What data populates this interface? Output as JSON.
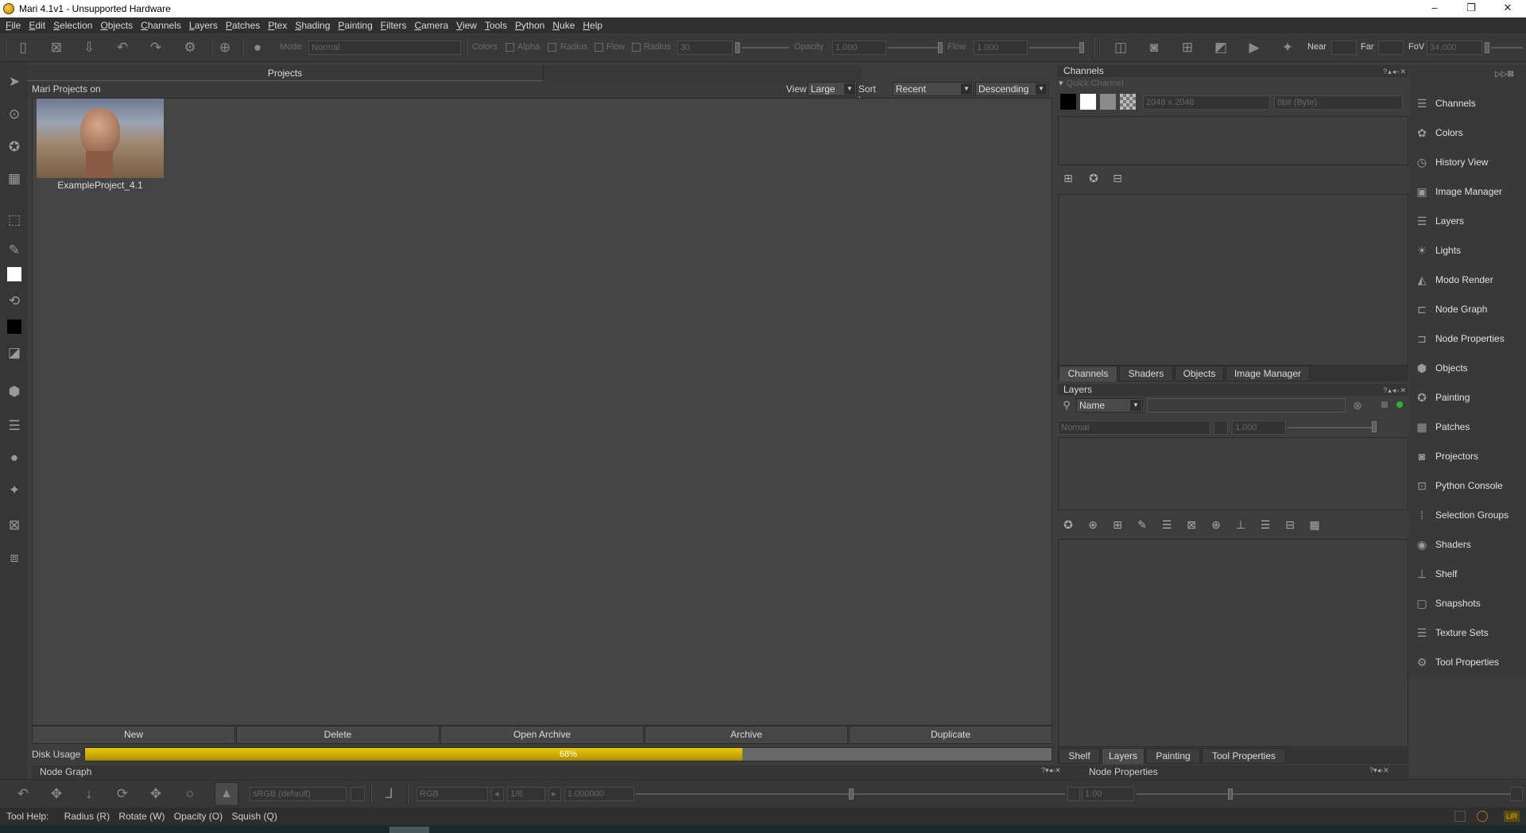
{
  "window": {
    "title": "Mari 4.1v1 - Unsupported Hardware",
    "min": "–",
    "max": "❐",
    "close": "✕"
  },
  "menu": [
    "File",
    "Edit",
    "Selection",
    "Objects",
    "Channels",
    "Layers",
    "Patches",
    "Ptex",
    "Shading",
    "Painting",
    "Filters",
    "Camera",
    "View",
    "Tools",
    "Python",
    "Nuke",
    "Help"
  ],
  "toolbar": {
    "mode_label": "Mode",
    "mode_value": "Normal",
    "colors_label": "Colors",
    "alpha_label": "Alpha",
    "radius_label": "Radius",
    "flow_label": "Flow",
    "radius2_label": "Radius",
    "radius_value": "30",
    "opacity_label": "Opacity",
    "opacity_value": "1.000",
    "flow2_label": "Flow",
    "flow_value": "1.000",
    "near_label": "Near",
    "far_label": "Far",
    "fov_label": "FoV",
    "fov_value": "34.000"
  },
  "projects": {
    "tab": "Projects",
    "heading": "Mari Projects on",
    "view_label": "View",
    "view_value": "Large",
    "sort_label": "Sort by",
    "sort_value": "Recent",
    "order_value": "Descending",
    "items": [
      {
        "name": "ExampleProject_4.1"
      }
    ],
    "buttons": {
      "new": "New",
      "delete": "Delete",
      "open_archive": "Open Archive",
      "archive": "Archive",
      "duplicate": "Duplicate"
    },
    "disk_label": "Disk Usage",
    "disk_percent": 68,
    "disk_text": "68%"
  },
  "channels_panel": {
    "title": "Channels",
    "quick_channel": "Quick Channel",
    "size_value": "2048 x 2048",
    "depth_value": "8bit (Byte)",
    "tabs": [
      "Channels",
      "Shaders",
      "Objects",
      "Image Manager"
    ]
  },
  "layers_panel": {
    "title": "Layers",
    "filter_value": "Name",
    "blend_value": "Normal",
    "opacity_value": "1.000",
    "tabs": [
      "Shelf",
      "Layers",
      "Painting",
      "Tool Properties"
    ]
  },
  "palettes": [
    {
      "label": "Channels",
      "icon": "channels-icon"
    },
    {
      "label": "Colors",
      "icon": "colors-icon"
    },
    {
      "label": "History View",
      "icon": "history-icon"
    },
    {
      "label": "Image Manager",
      "icon": "image-manager-icon"
    },
    {
      "label": "Layers",
      "icon": "layers-icon"
    },
    {
      "label": "Lights",
      "icon": "lights-icon"
    },
    {
      "label": "Modo Render",
      "icon": "modo-render-icon"
    },
    {
      "label": "Node Graph",
      "icon": "node-graph-icon"
    },
    {
      "label": "Node Properties",
      "icon": "node-properties-icon"
    },
    {
      "label": "Objects",
      "icon": "objects-icon"
    },
    {
      "label": "Painting",
      "icon": "painting-icon"
    },
    {
      "label": "Patches",
      "icon": "patches-icon"
    },
    {
      "label": "Projectors",
      "icon": "projectors-icon"
    },
    {
      "label": "Python Console",
      "icon": "python-console-icon"
    },
    {
      "label": "Selection Groups",
      "icon": "selection-groups-icon"
    },
    {
      "label": "Shaders",
      "icon": "shaders-icon"
    },
    {
      "label": "Shelf",
      "icon": "shelf-icon"
    },
    {
      "label": "Snapshots",
      "icon": "snapshots-icon"
    },
    {
      "label": "Texture Sets",
      "icon": "texture-sets-icon"
    },
    {
      "label": "Tool Properties",
      "icon": "tool-properties-icon"
    }
  ],
  "bottom": {
    "node_graph": "Node Graph",
    "node_properties": "Node Properties",
    "colorspace_value": "sRGB (default)",
    "channel_value": "RGB",
    "frame_value": "1/8",
    "gain_value": "1.000000",
    "gamma_value": "1.00"
  },
  "status": {
    "help_label": "Tool Help:",
    "radius": "Radius (R)",
    "rotate": "Rotate (W)",
    "opacity": "Opacity (O)",
    "squish": "Squish (Q)"
  }
}
